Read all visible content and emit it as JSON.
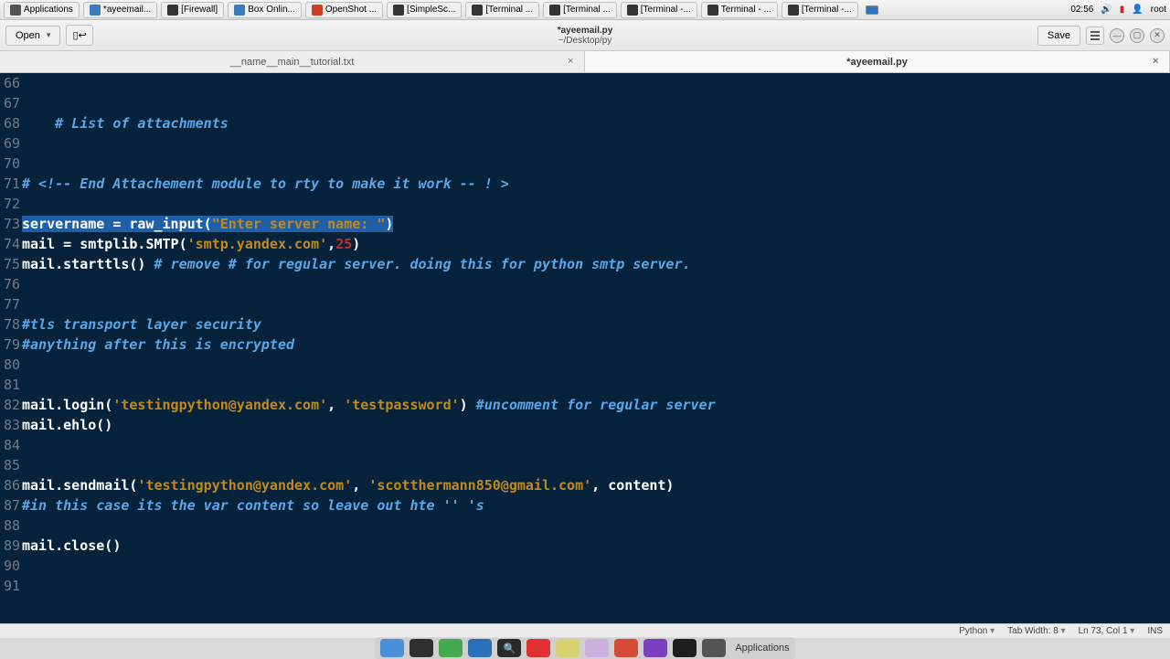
{
  "taskbar": {
    "applications_label": "Applications",
    "items": [
      {
        "label": "*ayeemail..."
      },
      {
        "label": "[Firewall]"
      },
      {
        "label": "Box Onlin..."
      },
      {
        "label": "OpenShot ..."
      },
      {
        "label": "[SimpleSc..."
      },
      {
        "label": "[Terminal ..."
      },
      {
        "label": "[Terminal ..."
      },
      {
        "label": "[Terminal -..."
      },
      {
        "label": "Terminal - ..."
      },
      {
        "label": "[Terminal -..."
      }
    ],
    "clock": "02:56",
    "user": "root"
  },
  "editor_bar": {
    "open_label": "Open",
    "recent_icon": "recent-documents",
    "title": "*ayeemail.py",
    "subtitle": "~/Desktop/py",
    "save_label": "Save"
  },
  "tabs": [
    {
      "label": "__name__main__tutorial.txt",
      "active": false
    },
    {
      "label": "*ayeemail.py",
      "active": true
    }
  ],
  "code": {
    "lines": [
      {
        "n": 66,
        "segs": []
      },
      {
        "n": 67,
        "segs": []
      },
      {
        "n": 68,
        "segs": [
          {
            "t": "    # List of attachments",
            "c": "c-comment"
          }
        ]
      },
      {
        "n": 69,
        "segs": []
      },
      {
        "n": 70,
        "segs": []
      },
      {
        "n": 71,
        "segs": [
          {
            "t": "# <!-- End Attachement module to rty to make it work -- ! >",
            "c": "c-comment"
          }
        ]
      },
      {
        "n": 72,
        "segs": []
      },
      {
        "n": 73,
        "sel": true,
        "segs": [
          {
            "t": "servername = raw_input(",
            "c": "c-white"
          },
          {
            "t": "\"Enter server name: \"",
            "c": "c-string"
          },
          {
            "t": ")",
            "c": "c-white"
          }
        ]
      },
      {
        "n": 74,
        "segs": [
          {
            "t": "mail = smtplib.SMTP(",
            "c": "c-white"
          },
          {
            "t": "'smtp.yandex.com'",
            "c": "c-string"
          },
          {
            "t": ",",
            "c": "c-white"
          },
          {
            "t": "25",
            "c": "c-num"
          },
          {
            "t": ")",
            "c": "c-white"
          }
        ]
      },
      {
        "n": 75,
        "segs": [
          {
            "t": "mail.starttls() ",
            "c": "c-white"
          },
          {
            "t": "# remove # for regular server. doing this for python smtp server.",
            "c": "c-comment"
          }
        ]
      },
      {
        "n": 76,
        "segs": []
      },
      {
        "n": 77,
        "segs": []
      },
      {
        "n": 78,
        "segs": [
          {
            "t": "#tls transport layer security",
            "c": "c-comment"
          }
        ]
      },
      {
        "n": 79,
        "segs": [
          {
            "t": "#anything after this is encrypted",
            "c": "c-comment"
          }
        ]
      },
      {
        "n": 80,
        "segs": []
      },
      {
        "n": 81,
        "segs": []
      },
      {
        "n": 82,
        "segs": [
          {
            "t": "mail.login(",
            "c": "c-white"
          },
          {
            "t": "'testingpython@yandex.com'",
            "c": "c-string"
          },
          {
            "t": ", ",
            "c": "c-white"
          },
          {
            "t": "'testpassword'",
            "c": "c-string"
          },
          {
            "t": ") ",
            "c": "c-white"
          },
          {
            "t": "#uncomment for regular server",
            "c": "c-comment"
          }
        ]
      },
      {
        "n": 83,
        "segs": [
          {
            "t": "mail.ehlo()",
            "c": "c-white"
          }
        ]
      },
      {
        "n": 84,
        "segs": []
      },
      {
        "n": 85,
        "segs": []
      },
      {
        "n": 86,
        "segs": [
          {
            "t": "mail.sendmail(",
            "c": "c-white"
          },
          {
            "t": "'testingpython@yandex.com'",
            "c": "c-string"
          },
          {
            "t": ", ",
            "c": "c-white"
          },
          {
            "t": "'scotthermann850@gmail.com'",
            "c": "c-string"
          },
          {
            "t": ", content)",
            "c": "c-white"
          }
        ]
      },
      {
        "n": 87,
        "segs": [
          {
            "t": "#in this case its the var content so leave out hte '' 's",
            "c": "c-comment"
          }
        ]
      },
      {
        "n": 88,
        "segs": []
      },
      {
        "n": 89,
        "segs": [
          {
            "t": "mail.close()",
            "c": "c-white"
          }
        ]
      },
      {
        "n": 90,
        "segs": []
      },
      {
        "n": 91,
        "segs": []
      }
    ]
  },
  "status": {
    "lang": "Python",
    "tab_width": "Tab Width: 8",
    "cursor": "Ln 73, Col 1",
    "ins": "INS"
  },
  "dock": {
    "label": "Applications"
  }
}
